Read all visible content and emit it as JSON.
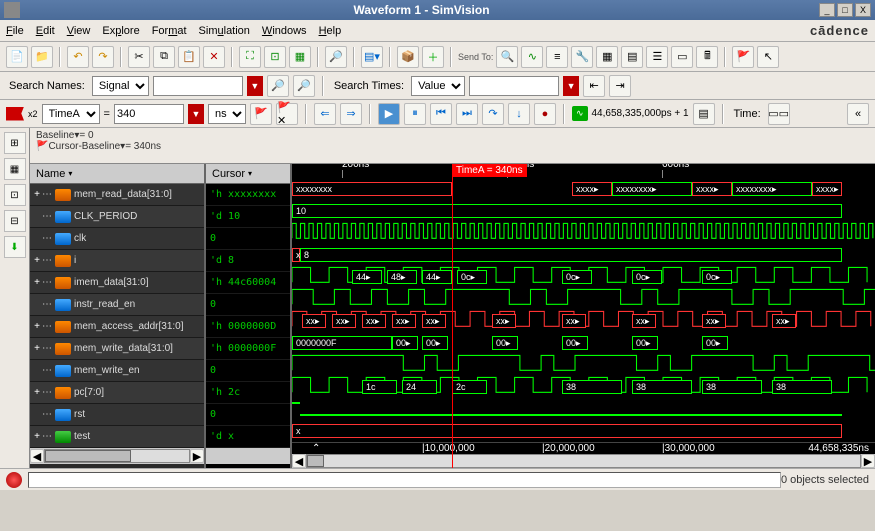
{
  "title": "Waveform 1 - SimVision",
  "brand": "cādence",
  "menus": {
    "file": "File",
    "edit": "Edit",
    "view": "View",
    "explore": "Explore",
    "format": "Format",
    "simulation": "Simulation",
    "windows": "Windows",
    "help": "Help"
  },
  "toolbar": {
    "sendto": "Send To:"
  },
  "search": {
    "names_label": "Search Names:",
    "names_mode": "Signal",
    "names_value": "",
    "times_label": "Search Times:",
    "times_mode": "Value",
    "times_value": ""
  },
  "timebar": {
    "x2": "x2",
    "marker_name": "TimeA",
    "marker_value": "340",
    "units": "ns",
    "sim_time": "44,658,335,000ps + 1",
    "time_label": "Time:"
  },
  "baseline": {
    "baseline_label": "Baseline",
    "baseline_value": "= 0",
    "cursor_baseline_label": "Cursor-Baseline",
    "cursor_baseline_value": "= 340ns"
  },
  "panels": {
    "name_header": "Name",
    "cursor_header": "Cursor"
  },
  "signals": [
    {
      "name": "mem_read_data[31:0]",
      "icon": "bus",
      "expand": "+",
      "cursor": "'h xxxxxxxx"
    },
    {
      "name": "CLK_PERIOD",
      "icon": "sig",
      "expand": "",
      "cursor": "'d 10"
    },
    {
      "name": "clk",
      "icon": "sig",
      "expand": "",
      "cursor": "0"
    },
    {
      "name": "i",
      "icon": "bus",
      "expand": "+",
      "cursor": "'d 8"
    },
    {
      "name": "imem_data[31:0]",
      "icon": "bus",
      "expand": "+",
      "cursor": "'h 44c60004"
    },
    {
      "name": "instr_read_en",
      "icon": "sig",
      "expand": "",
      "cursor": "0"
    },
    {
      "name": "mem_access_addr[31:0]",
      "icon": "bus",
      "expand": "+",
      "cursor": "'h 0000000D"
    },
    {
      "name": "mem_write_data[31:0]",
      "icon": "bus",
      "expand": "+",
      "cursor": "'h 0000000F"
    },
    {
      "name": "mem_write_en",
      "icon": "sig",
      "expand": "",
      "cursor": "0"
    },
    {
      "name": "pc[7:0]",
      "icon": "bus",
      "expand": "+",
      "cursor": "'h 2c"
    },
    {
      "name": "rst",
      "icon": "sig",
      "expand": "",
      "cursor": "0"
    },
    {
      "name": "test",
      "icon": "grp",
      "expand": "+",
      "cursor": "'d x"
    }
  ],
  "timeline": {
    "marker_flag": "TimeA = 340ns",
    "ticks": [
      "200ns",
      "400ns",
      "600ns"
    ],
    "footer_ticks": [
      "|10,000,000",
      "|20,000,000",
      "|30,000,000",
      "44,658,335ns"
    ]
  },
  "wave_labels": {
    "mem_read_data": [
      "xxxxxxxx",
      "xxxx",
      "xxxxxxxx",
      "xxxx",
      "xxxxxxxx",
      "xxxx"
    ],
    "clk_period": "10",
    "i": "8",
    "imem_data": [
      "44",
      "48",
      "44",
      "0c",
      "0c",
      "0c",
      "0c"
    ],
    "mem_access_addr": [
      "xx",
      "xx",
      "xx",
      "xx",
      "xx",
      "xx",
      "xx",
      "xx",
      "xx",
      "xx"
    ],
    "mem_write_data": [
      "0000000F",
      "00",
      "00",
      "00",
      "00",
      "00",
      "00"
    ],
    "pc": [
      "1c",
      "24",
      "2c",
      "38",
      "38",
      "38",
      "38"
    ],
    "test": "x"
  },
  "status": {
    "objects": "0 objects selected"
  }
}
